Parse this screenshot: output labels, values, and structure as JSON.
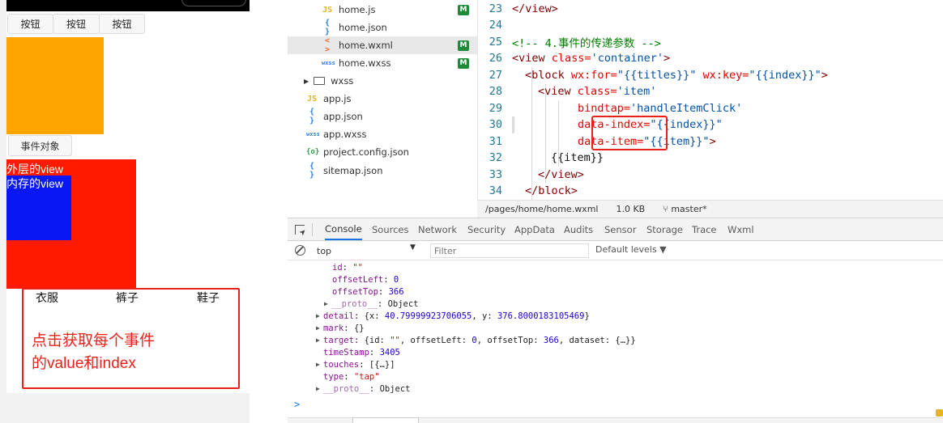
{
  "simulator": {
    "buttons": [
      "按钮",
      "按钮",
      "按钮"
    ],
    "event_button": "事件对象",
    "outer_view_text": "外层的view",
    "inner_view_text": "内存的view",
    "items": [
      "衣服",
      "裤子",
      "鞋子"
    ],
    "note_lines": [
      "点击获取每个事件",
      "的value和index"
    ],
    "colors": {
      "orange": "#ffa500",
      "outer": "#ff1a00",
      "inner": "#0a17f5",
      "note": "#e8221a"
    }
  },
  "file_tree": {
    "items": [
      {
        "icon": "js-file-icon",
        "glyph": "JS",
        "name": "home.js",
        "badge": "M"
      },
      {
        "icon": "json-file-icon",
        "glyph": "{ }",
        "name": "home.json",
        "badge": ""
      },
      {
        "icon": "wxml-file-icon",
        "glyph": "< >",
        "name": "home.wxml",
        "badge": "M",
        "selected": true
      },
      {
        "icon": "wxss-file-icon",
        "glyph": "wxss",
        "name": "home.wxss",
        "badge": "M"
      },
      {
        "icon": "folder-icon",
        "glyph": "",
        "name": "wxss",
        "badge": ""
      },
      {
        "icon": "js-file-icon",
        "glyph": "JS",
        "name": "app.js",
        "badge": ""
      },
      {
        "icon": "json-file-icon",
        "glyph": "{ }",
        "name": "app.json",
        "badge": ""
      },
      {
        "icon": "wxss-file-icon",
        "glyph": "wxss",
        "name": "app.wxss",
        "badge": ""
      },
      {
        "icon": "config-file-icon",
        "glyph": "{o}",
        "name": "project.config.json",
        "badge": ""
      },
      {
        "icon": "json-file-icon",
        "glyph": "{ }",
        "name": "sitemap.json",
        "badge": ""
      }
    ]
  },
  "editor": {
    "line_numbers": [
      "23",
      "24",
      "25",
      "26",
      "27",
      "28",
      "29",
      "30",
      "31",
      "32",
      "33",
      "34"
    ],
    "lines": {
      "l23": "</view>",
      "l25": "<!-- 4.事件的传递参数 -->",
      "l26_tag": "<view ",
      "l26_attr": "class=",
      "l26_val": "'container'",
      "l26_end": ">",
      "l27_tag": "<block ",
      "l27_attr1": "wx:for=",
      "l27_val1": "\"{{titles}}\"",
      "l27_attr2": " wx:key=",
      "l27_val2": "\"{{index}}\"",
      "l27_end": ">",
      "l28_tag": "<view ",
      "l28_attr": "class=",
      "l28_val": "'item'",
      "l29_attr": "bindtap=",
      "l29_val": "'handleItemClick'",
      "l30_attr": "data-index=",
      "l30_val": "\"{{index}}\"",
      "l31_attr": "data-item=",
      "l31_val": "\"{{item}}\"",
      "l31_end": ">",
      "l32": "{{item}}",
      "l33": "</view>",
      "l34": "</block>"
    },
    "status": {
      "path": "/pages/home/home.wxml",
      "size": "1.0 KB",
      "branch": "master*"
    }
  },
  "devtools": {
    "tabs": [
      "Console",
      "Sources",
      "Network",
      "Security",
      "AppData",
      "Audits",
      "Sensor",
      "Storage",
      "Trace",
      "Wxml"
    ],
    "active_tab": "Console",
    "context": "top",
    "filter_placeholder": "Filter",
    "levels": "Default levels ▼",
    "console": {
      "id_key": "id",
      "id_val": "\"\"",
      "offsetLeft_key": "offsetLeft",
      "offsetLeft_val": "0",
      "offsetTop_key": "offsetTop",
      "offsetTop_val": "366",
      "proto1_key": "__proto__",
      "proto1_val": "Object",
      "detail_key": "detail",
      "detail_pre": "{x: ",
      "detail_x": "40.79999923706055",
      "detail_mid": ", y: ",
      "detail_y": "376.8000183105469",
      "detail_post": "}",
      "mark_key": "mark",
      "mark_val": "{}",
      "target_key": "target",
      "target_pre": "{id: ",
      "target_id": "\"\"",
      "target_mid1": ", offsetLeft: ",
      "target_ol": "0",
      "target_mid2": ", offsetTop: ",
      "target_ot": "366",
      "target_post": ", dataset: {…}}",
      "timeStamp_key": "timeStamp",
      "timeStamp_val": "3405",
      "touches_key": "touches",
      "touches_val": "[{…}]",
      "type_key": "type",
      "type_val": "\"tap\"",
      "proto2_key": "__proto__",
      "proto2_val": "Object"
    },
    "prompt": ">"
  }
}
